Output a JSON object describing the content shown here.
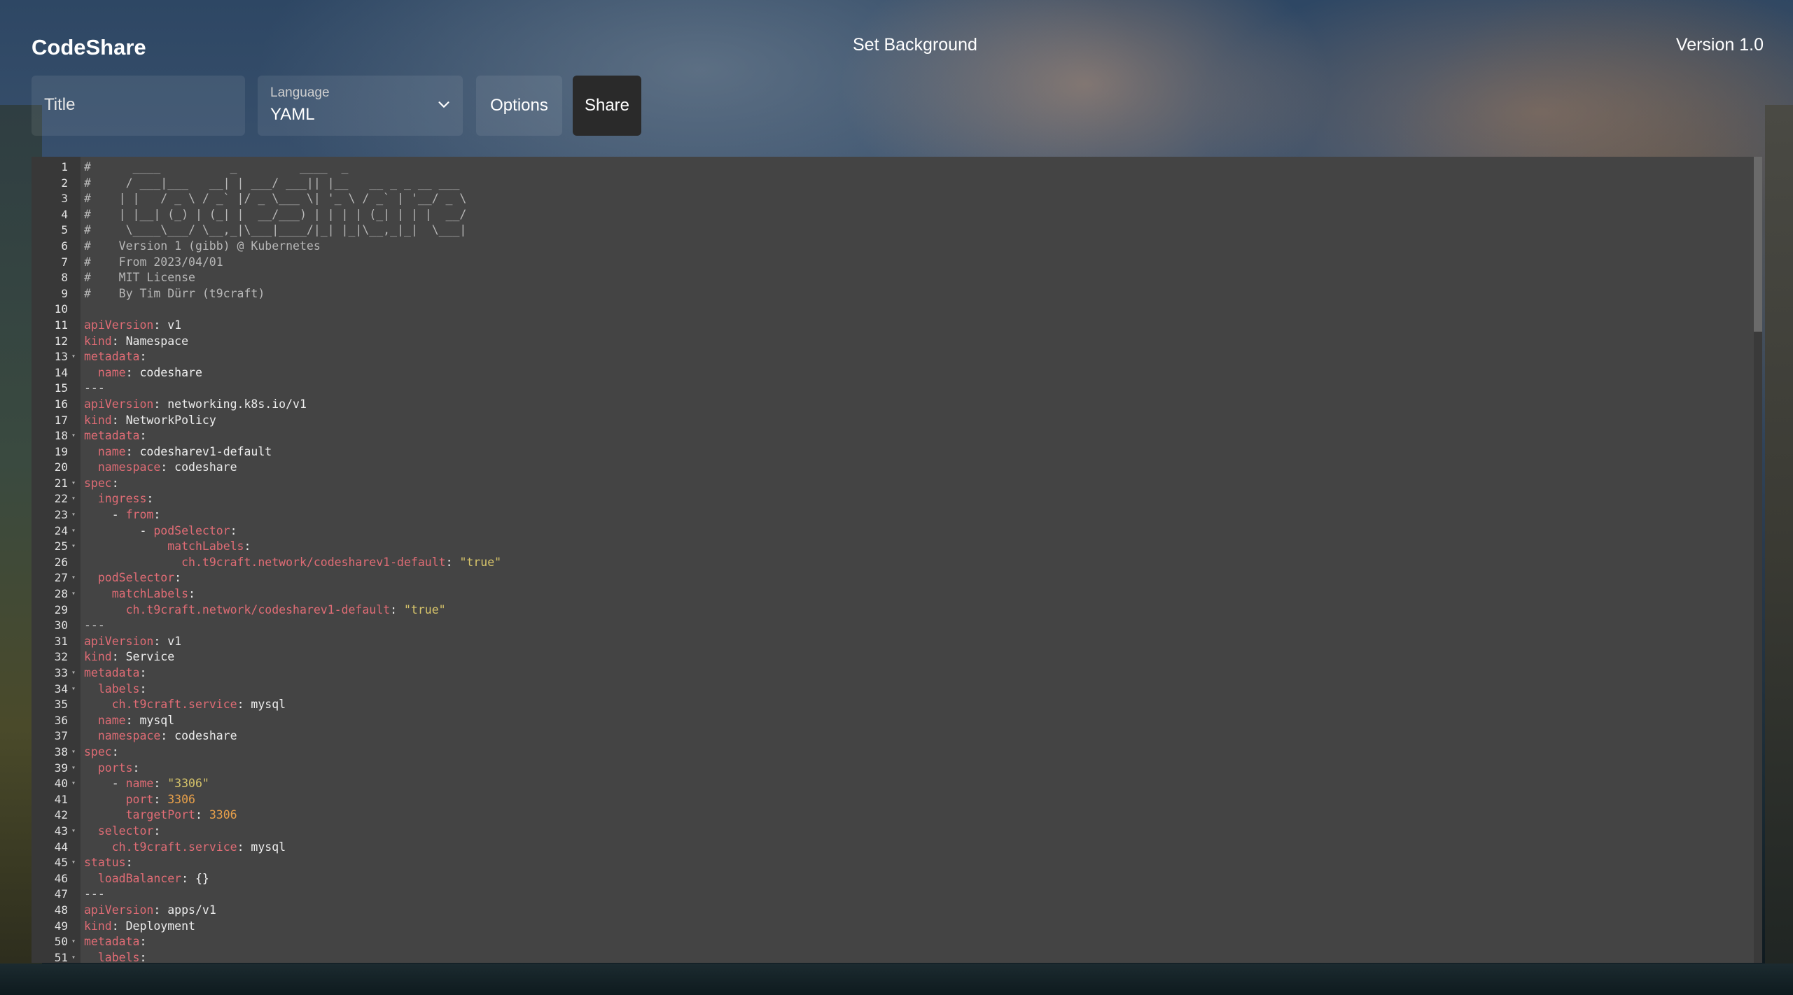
{
  "header": {
    "brand": "CodeShare",
    "set_background": "Set Background",
    "version": "Version 1.0"
  },
  "toolbar": {
    "title_placeholder": "Title",
    "language_label": "Language",
    "language_value": "YAML",
    "options_label": "Options",
    "share_label": "Share"
  },
  "editor": {
    "lines": [
      {
        "n": "1",
        "fold": false,
        "tokens": [
          {
            "t": "comment",
            "v": "#      ____          _         ____  _"
          }
        ]
      },
      {
        "n": "2",
        "fold": false,
        "tokens": [
          {
            "t": "comment",
            "v": "#     / ___|___   __| | ___/ ___|| |__   __ _ _ __ ___"
          }
        ]
      },
      {
        "n": "3",
        "fold": false,
        "tokens": [
          {
            "t": "comment",
            "v": "#    | |   / _ \\ / _` |/ _ \\___ \\| '_ \\ / _` | '__/ _ \\"
          }
        ]
      },
      {
        "n": "4",
        "fold": false,
        "tokens": [
          {
            "t": "comment",
            "v": "#    | |__| (_) | (_| |  __/___) | | | | (_| | | |  __/"
          }
        ]
      },
      {
        "n": "5",
        "fold": false,
        "tokens": [
          {
            "t": "comment",
            "v": "#     \\____\\___/ \\__,_|\\___|____/|_| |_|\\__,_|_|  \\___|"
          }
        ]
      },
      {
        "n": "6",
        "fold": false,
        "tokens": [
          {
            "t": "comment",
            "v": "#    Version 1 (gibb) @ Kubernetes"
          }
        ]
      },
      {
        "n": "7",
        "fold": false,
        "tokens": [
          {
            "t": "comment",
            "v": "#    From 2023/04/01"
          }
        ]
      },
      {
        "n": "8",
        "fold": false,
        "tokens": [
          {
            "t": "comment",
            "v": "#    MIT License"
          }
        ]
      },
      {
        "n": "9",
        "fold": false,
        "tokens": [
          {
            "t": "comment",
            "v": "#    By Tim Dürr (t9craft)"
          }
        ]
      },
      {
        "n": "10",
        "fold": false,
        "tokens": []
      },
      {
        "n": "11",
        "fold": false,
        "tokens": [
          {
            "t": "key",
            "v": "apiVersion"
          },
          {
            "t": "plain",
            "v": ": v1"
          }
        ]
      },
      {
        "n": "12",
        "fold": false,
        "tokens": [
          {
            "t": "key",
            "v": "kind"
          },
          {
            "t": "plain",
            "v": ": Namespace"
          }
        ]
      },
      {
        "n": "13",
        "fold": true,
        "tokens": [
          {
            "t": "key",
            "v": "metadata"
          },
          {
            "t": "plain",
            "v": ":"
          }
        ]
      },
      {
        "n": "14",
        "fold": false,
        "tokens": [
          {
            "t": "plain",
            "v": "  "
          },
          {
            "t": "key",
            "v": "name"
          },
          {
            "t": "plain",
            "v": ": codeshare"
          }
        ]
      },
      {
        "n": "15",
        "fold": false,
        "tokens": [
          {
            "t": "meta",
            "v": "---"
          }
        ]
      },
      {
        "n": "16",
        "fold": false,
        "tokens": [
          {
            "t": "key",
            "v": "apiVersion"
          },
          {
            "t": "plain",
            "v": ": networking.k8s.io/v1"
          }
        ]
      },
      {
        "n": "17",
        "fold": false,
        "tokens": [
          {
            "t": "key",
            "v": "kind"
          },
          {
            "t": "plain",
            "v": ": NetworkPolicy"
          }
        ]
      },
      {
        "n": "18",
        "fold": true,
        "tokens": [
          {
            "t": "key",
            "v": "metadata"
          },
          {
            "t": "plain",
            "v": ":"
          }
        ]
      },
      {
        "n": "19",
        "fold": false,
        "tokens": [
          {
            "t": "plain",
            "v": "  "
          },
          {
            "t": "key",
            "v": "name"
          },
          {
            "t": "plain",
            "v": ": codesharev1-default"
          }
        ]
      },
      {
        "n": "20",
        "fold": false,
        "tokens": [
          {
            "t": "plain",
            "v": "  "
          },
          {
            "t": "key",
            "v": "namespace"
          },
          {
            "t": "plain",
            "v": ": codeshare"
          }
        ]
      },
      {
        "n": "21",
        "fold": true,
        "tokens": [
          {
            "t": "key",
            "v": "spec"
          },
          {
            "t": "plain",
            "v": ":"
          }
        ]
      },
      {
        "n": "22",
        "fold": true,
        "tokens": [
          {
            "t": "plain",
            "v": "  "
          },
          {
            "t": "key",
            "v": "ingress"
          },
          {
            "t": "plain",
            "v": ":"
          }
        ]
      },
      {
        "n": "23",
        "fold": true,
        "tokens": [
          {
            "t": "plain",
            "v": "    - "
          },
          {
            "t": "key",
            "v": "from"
          },
          {
            "t": "plain",
            "v": ":"
          }
        ]
      },
      {
        "n": "24",
        "fold": true,
        "tokens": [
          {
            "t": "plain",
            "v": "        - "
          },
          {
            "t": "key",
            "v": "podSelector"
          },
          {
            "t": "plain",
            "v": ":"
          }
        ]
      },
      {
        "n": "25",
        "fold": true,
        "tokens": [
          {
            "t": "plain",
            "v": "            "
          },
          {
            "t": "key",
            "v": "matchLabels"
          },
          {
            "t": "plain",
            "v": ":"
          }
        ]
      },
      {
        "n": "26",
        "fold": false,
        "tokens": [
          {
            "t": "plain",
            "v": "              "
          },
          {
            "t": "key",
            "v": "ch.t9craft.network/codesharev1-default"
          },
          {
            "t": "plain",
            "v": ": "
          },
          {
            "t": "str",
            "v": "\"true\""
          }
        ]
      },
      {
        "n": "27",
        "fold": true,
        "tokens": [
          {
            "t": "plain",
            "v": "  "
          },
          {
            "t": "key",
            "v": "podSelector"
          },
          {
            "t": "plain",
            "v": ":"
          }
        ]
      },
      {
        "n": "28",
        "fold": true,
        "tokens": [
          {
            "t": "plain",
            "v": "    "
          },
          {
            "t": "key",
            "v": "matchLabels"
          },
          {
            "t": "plain",
            "v": ":"
          }
        ]
      },
      {
        "n": "29",
        "fold": false,
        "tokens": [
          {
            "t": "plain",
            "v": "      "
          },
          {
            "t": "key",
            "v": "ch.t9craft.network/codesharev1-default"
          },
          {
            "t": "plain",
            "v": ": "
          },
          {
            "t": "str",
            "v": "\"true\""
          }
        ]
      },
      {
        "n": "30",
        "fold": false,
        "tokens": [
          {
            "t": "meta",
            "v": "---"
          }
        ]
      },
      {
        "n": "31",
        "fold": false,
        "tokens": [
          {
            "t": "key",
            "v": "apiVersion"
          },
          {
            "t": "plain",
            "v": ": v1"
          }
        ]
      },
      {
        "n": "32",
        "fold": false,
        "tokens": [
          {
            "t": "key",
            "v": "kind"
          },
          {
            "t": "plain",
            "v": ": Service"
          }
        ]
      },
      {
        "n": "33",
        "fold": true,
        "tokens": [
          {
            "t": "key",
            "v": "metadata"
          },
          {
            "t": "plain",
            "v": ":"
          }
        ]
      },
      {
        "n": "34",
        "fold": true,
        "tokens": [
          {
            "t": "plain",
            "v": "  "
          },
          {
            "t": "key",
            "v": "labels"
          },
          {
            "t": "plain",
            "v": ":"
          }
        ]
      },
      {
        "n": "35",
        "fold": false,
        "tokens": [
          {
            "t": "plain",
            "v": "    "
          },
          {
            "t": "key",
            "v": "ch.t9craft.service"
          },
          {
            "t": "plain",
            "v": ": mysql"
          }
        ]
      },
      {
        "n": "36",
        "fold": false,
        "tokens": [
          {
            "t": "plain",
            "v": "  "
          },
          {
            "t": "key",
            "v": "name"
          },
          {
            "t": "plain",
            "v": ": mysql"
          }
        ]
      },
      {
        "n": "37",
        "fold": false,
        "tokens": [
          {
            "t": "plain",
            "v": "  "
          },
          {
            "t": "key",
            "v": "namespace"
          },
          {
            "t": "plain",
            "v": ": codeshare"
          }
        ]
      },
      {
        "n": "38",
        "fold": true,
        "tokens": [
          {
            "t": "key",
            "v": "spec"
          },
          {
            "t": "plain",
            "v": ":"
          }
        ]
      },
      {
        "n": "39",
        "fold": true,
        "tokens": [
          {
            "t": "plain",
            "v": "  "
          },
          {
            "t": "key",
            "v": "ports"
          },
          {
            "t": "plain",
            "v": ":"
          }
        ]
      },
      {
        "n": "40",
        "fold": true,
        "tokens": [
          {
            "t": "plain",
            "v": "    - "
          },
          {
            "t": "key",
            "v": "name"
          },
          {
            "t": "plain",
            "v": ": "
          },
          {
            "t": "str",
            "v": "\"3306\""
          }
        ]
      },
      {
        "n": "41",
        "fold": false,
        "tokens": [
          {
            "t": "plain",
            "v": "      "
          },
          {
            "t": "key",
            "v": "port"
          },
          {
            "t": "plain",
            "v": ": "
          },
          {
            "t": "num",
            "v": "3306"
          }
        ]
      },
      {
        "n": "42",
        "fold": false,
        "tokens": [
          {
            "t": "plain",
            "v": "      "
          },
          {
            "t": "key",
            "v": "targetPort"
          },
          {
            "t": "plain",
            "v": ": "
          },
          {
            "t": "num",
            "v": "3306"
          }
        ]
      },
      {
        "n": "43",
        "fold": true,
        "tokens": [
          {
            "t": "plain",
            "v": "  "
          },
          {
            "t": "key",
            "v": "selector"
          },
          {
            "t": "plain",
            "v": ":"
          }
        ]
      },
      {
        "n": "44",
        "fold": false,
        "tokens": [
          {
            "t": "plain",
            "v": "    "
          },
          {
            "t": "key",
            "v": "ch.t9craft.service"
          },
          {
            "t": "plain",
            "v": ": mysql"
          }
        ]
      },
      {
        "n": "45",
        "fold": true,
        "tokens": [
          {
            "t": "key",
            "v": "status"
          },
          {
            "t": "plain",
            "v": ":"
          }
        ]
      },
      {
        "n": "46",
        "fold": false,
        "tokens": [
          {
            "t": "plain",
            "v": "  "
          },
          {
            "t": "key",
            "v": "loadBalancer"
          },
          {
            "t": "plain",
            "v": ": {}"
          }
        ]
      },
      {
        "n": "47",
        "fold": false,
        "tokens": [
          {
            "t": "meta",
            "v": "---"
          }
        ]
      },
      {
        "n": "48",
        "fold": false,
        "tokens": [
          {
            "t": "key",
            "v": "apiVersion"
          },
          {
            "t": "plain",
            "v": ": apps/v1"
          }
        ]
      },
      {
        "n": "49",
        "fold": false,
        "tokens": [
          {
            "t": "key",
            "v": "kind"
          },
          {
            "t": "plain",
            "v": ": Deployment"
          }
        ]
      },
      {
        "n": "50",
        "fold": true,
        "tokens": [
          {
            "t": "key",
            "v": "metadata"
          },
          {
            "t": "plain",
            "v": ":"
          }
        ]
      },
      {
        "n": "51",
        "fold": true,
        "tokens": [
          {
            "t": "plain",
            "v": "  "
          },
          {
            "t": "key",
            "v": "labels"
          },
          {
            "t": "plain",
            "v": ":"
          }
        ]
      }
    ]
  }
}
